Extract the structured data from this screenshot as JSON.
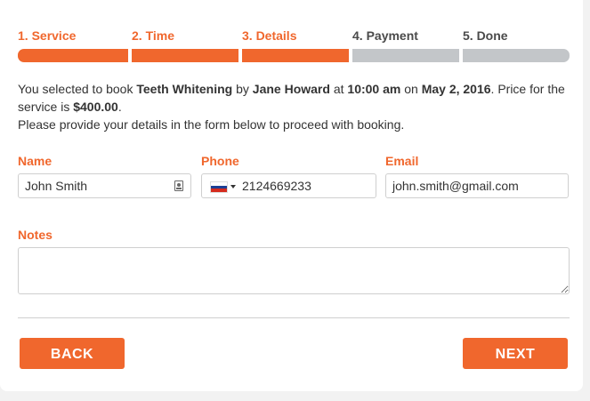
{
  "steps": [
    {
      "label": "1. Service",
      "state": "active"
    },
    {
      "label": "2. Time",
      "state": "active"
    },
    {
      "label": "3. Details",
      "state": "active"
    },
    {
      "label": "4. Payment",
      "state": "inactive"
    },
    {
      "label": "5. Done",
      "state": "inactive"
    }
  ],
  "summary": {
    "t1": "You selected to book ",
    "service": "Teeth Whitening",
    "t2": " by ",
    "staff": "Jane Howard",
    "t3": " at ",
    "time": "10:00 am",
    "t4": " on ",
    "date": "May 2, 2016",
    "t5": ". Price for the service is ",
    "price": "$400.00",
    "t6": ".",
    "line2": "Please provide your details in the form below to proceed with booking."
  },
  "form": {
    "name_label": "Name",
    "name_value": "John Smith",
    "phone_label": "Phone",
    "phone_value": "2124669233",
    "phone_flag_colors": [
      "#ffffff",
      "#1c3f94",
      "#d52b1e"
    ],
    "email_label": "Email",
    "email_value": "john.smith@gmail.com",
    "notes_label": "Notes",
    "notes_value": ""
  },
  "buttons": {
    "back": "BACK",
    "next": "NEXT"
  },
  "colors": {
    "accent": "#f0672d",
    "inactive": "#c3c6c9"
  }
}
